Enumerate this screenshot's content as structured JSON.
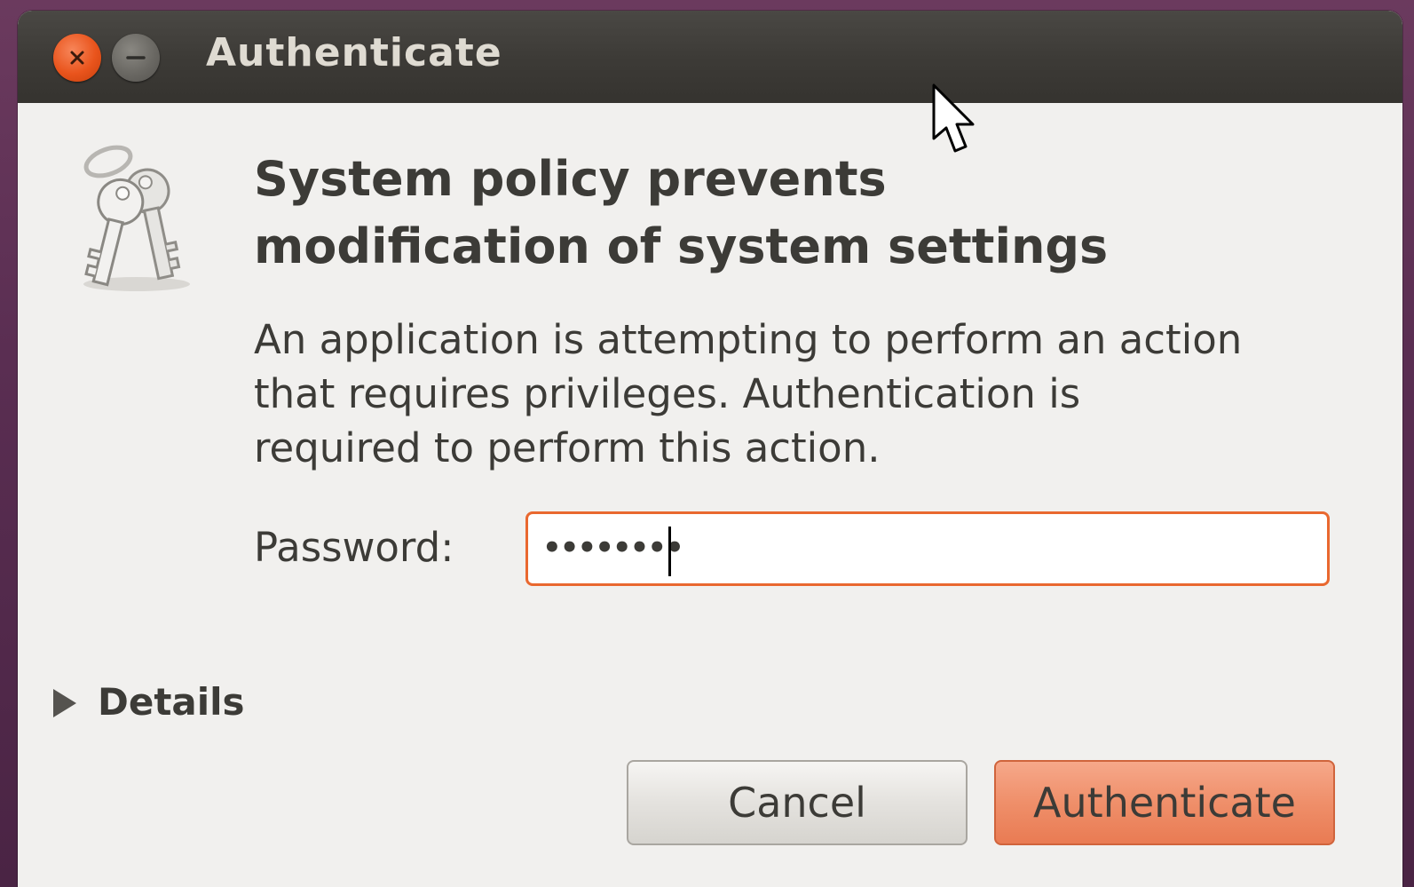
{
  "window": {
    "title": "Authenticate"
  },
  "dialog": {
    "heading_line1": "System policy prevents",
    "heading_line2": "modification of system settings",
    "message_line1": "An application is attempting to perform an action",
    "message_line2": "that requires privileges. Authentication is",
    "message_line3": "required to perform this action.",
    "password_label": "Password:",
    "password_value": "••••••••",
    "details_label": "Details",
    "cancel_label": "Cancel",
    "authenticate_label": "Authenticate"
  },
  "icons": {
    "close": "close-icon",
    "minimize": "minimize-icon",
    "keys": "keys-icon",
    "expander": "expander-arrow-icon",
    "pointer": "mouse-pointer-icon"
  },
  "colors": {
    "accent": "#e9541c",
    "focus_border": "#e9682f",
    "default_button": "#ef8f6a",
    "titlebar": "#3d3b37",
    "text": "#3c3b37"
  }
}
